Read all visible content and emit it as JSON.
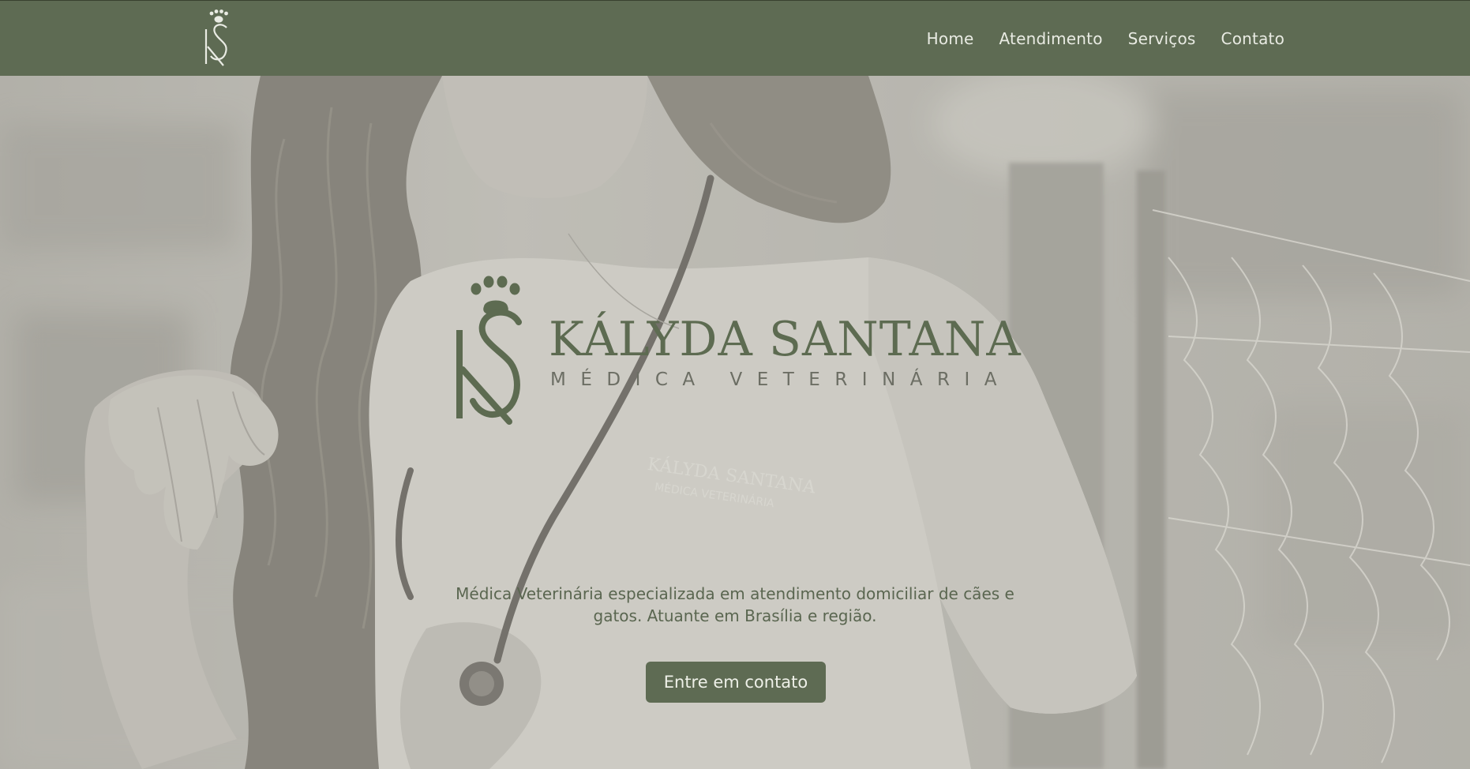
{
  "header": {
    "logo_icon": "ks-paw-monogram-icon",
    "nav": [
      {
        "label": "Home"
      },
      {
        "label": "Atendimento"
      },
      {
        "label": "Serviços"
      },
      {
        "label": "Contato"
      }
    ]
  },
  "hero": {
    "background_image": "woman-with-stethoscope-photo",
    "brand": {
      "name": "KÁLYDA SANTANA",
      "subtitle": "MÉDICA VETERINÁRIA",
      "mark_icon": "ks-paw-monogram-icon"
    },
    "tagline": "Médica Veterinária especializada em atendimento domiciliar de cães e gatos. Atuante em Brasília e região.",
    "cta_label": "Entre em contato"
  },
  "colors": {
    "primary": "#5e6b53",
    "nav_text": "#e9ebe3",
    "brand_text": "#5d6b51",
    "subtitle_text": "#6c6e64",
    "tagline_text": "#5a6650"
  }
}
